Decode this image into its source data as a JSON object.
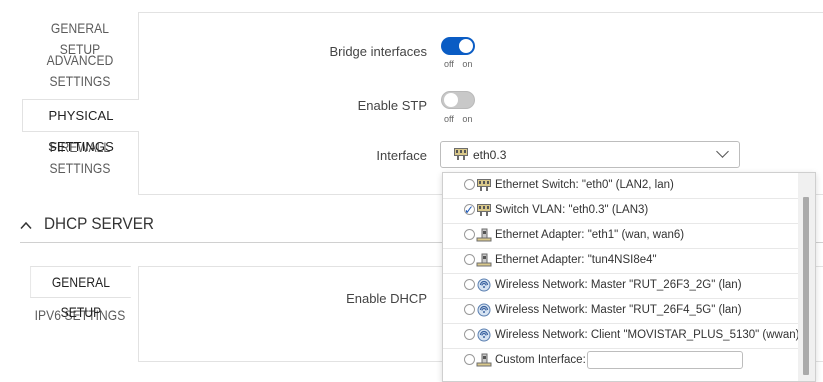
{
  "lan_tabs": [
    {
      "label": "GENERAL SETUP",
      "active": false
    },
    {
      "label": "ADVANCED SETTINGS",
      "active": false
    },
    {
      "label": "PHYSICAL SETTINGS",
      "active": true
    },
    {
      "label": "FIREWALL SETTINGS",
      "active": false
    }
  ],
  "bridge": {
    "label": "Bridge interfaces",
    "state": "on",
    "caption_off": "off",
    "caption_on": "on"
  },
  "stp": {
    "label": "Enable STP",
    "state": "off",
    "caption_off": "off",
    "caption_on": "on"
  },
  "interface": {
    "label": "Interface",
    "selected": "eth0.3",
    "options": [
      {
        "label": "Ethernet Switch: \"eth0\" (LAN2, lan)",
        "icon": "ethernet-switch-icon",
        "checked": false
      },
      {
        "label": "Switch VLAN: \"eth0.3\" (LAN3)",
        "icon": "ethernet-switch-icon",
        "checked": true
      },
      {
        "label": "Ethernet Adapter: \"eth1\" (wan, wan6)",
        "icon": "ethernet-adapter-icon",
        "checked": false
      },
      {
        "label": "Ethernet Adapter: \"tun4NSI8e4\"",
        "icon": "ethernet-adapter-icon",
        "checked": false
      },
      {
        "label": "Wireless Network: Master \"RUT_26F3_2G\" (lan)",
        "icon": "wireless-icon",
        "checked": false
      },
      {
        "label": "Wireless Network: Master \"RUT_26F4_5G\" (lan)",
        "icon": "wireless-icon",
        "checked": false
      },
      {
        "label": "Wireless Network: Client \"MOVISTAR_PLUS_5130\" (wwan)",
        "icon": "wireless-icon",
        "checked": false
      },
      {
        "label": "Custom Interface:",
        "icon": "ethernet-adapter-icon",
        "checked": false,
        "custom": true
      }
    ]
  },
  "dhcp": {
    "title": "DHCP SERVER",
    "tabs": [
      {
        "label": "GENERAL SETUP",
        "active": true
      },
      {
        "label": "IPV6 SETTINGS",
        "active": false
      }
    ],
    "enable_label": "Enable DHCP"
  },
  "colors": {
    "accent": "#0a5cc4",
    "check": "#1c57b6"
  }
}
